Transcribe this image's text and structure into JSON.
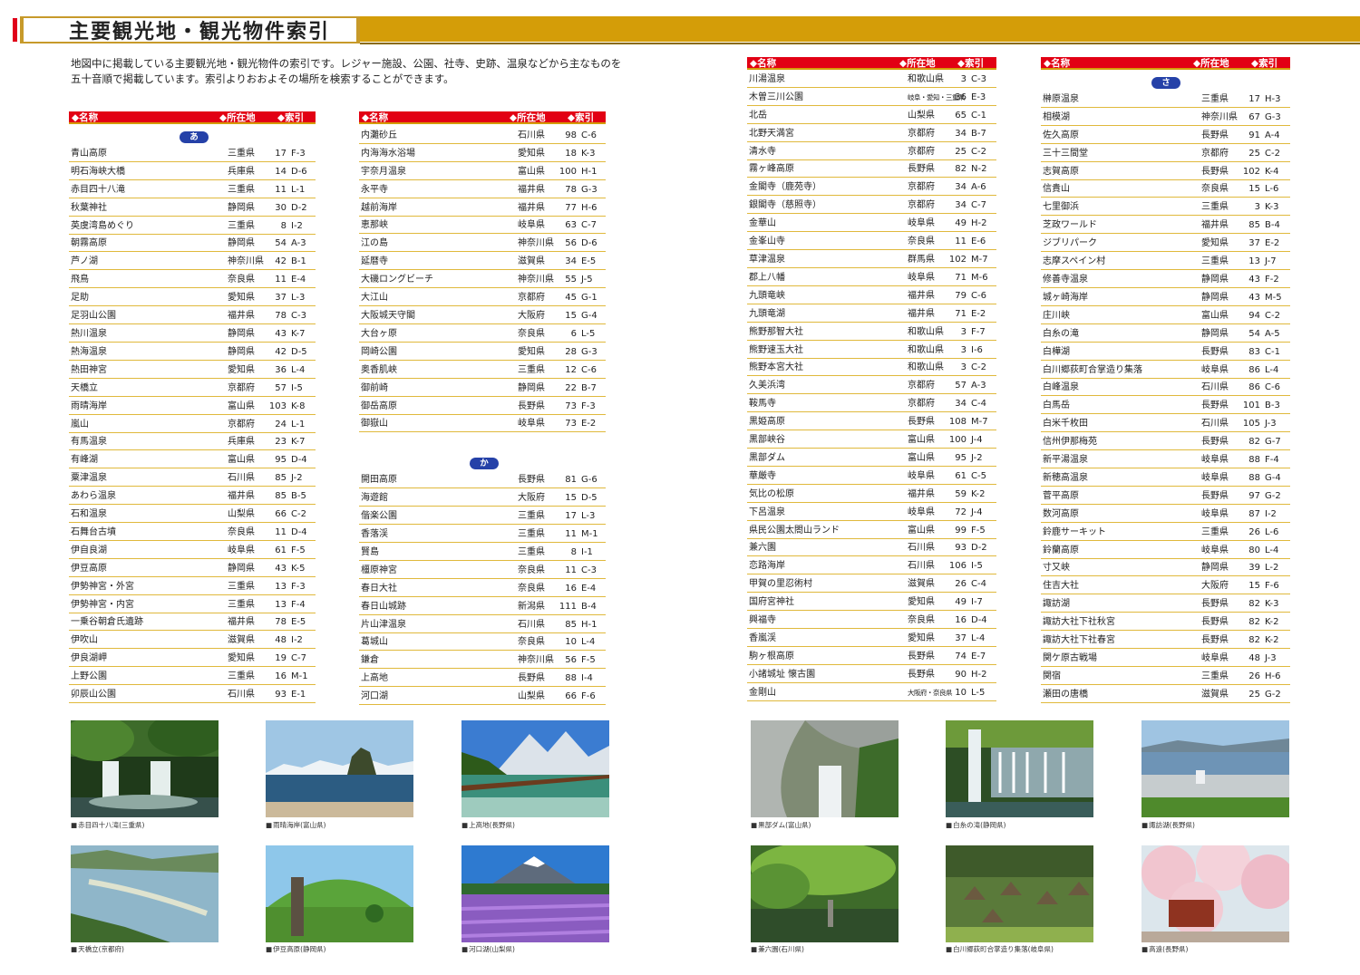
{
  "title": "主要観光地・観光物件索引",
  "intro": "地図中に掲載している主要観光地・観光物件の索引です。レジャー施設、公園、社寺、史跡、温泉などから主なものを五十音順で掲載しています。索引よりおおよその場所を検索することができます。",
  "header_labels": {
    "name": "◆名称",
    "pref": "◆所在地",
    "idx": "◆索引"
  },
  "section_a": "あ",
  "section_ka": "か",
  "section_sa": "さ",
  "col1": [
    [
      "青山高原",
      "三重県",
      "17",
      "F-3"
    ],
    [
      "明石海峡大橋",
      "兵庫県",
      "14",
      "D-6"
    ],
    [
      "赤目四十八滝",
      "三重県",
      "11",
      "L-1"
    ],
    [
      "秋葉神社",
      "静岡県",
      "30",
      "D-2"
    ],
    [
      "英虞湾島めぐり",
      "三重県",
      "8",
      "I-2"
    ],
    [
      "朝霧高原",
      "静岡県",
      "54",
      "A-3"
    ],
    [
      "芦ノ湖",
      "神奈川県",
      "42",
      "B-1"
    ],
    [
      "飛鳥",
      "奈良県",
      "11",
      "E-4"
    ],
    [
      "足助",
      "愛知県",
      "37",
      "L-3"
    ],
    [
      "足羽山公園",
      "福井県",
      "78",
      "C-3"
    ],
    [
      "熱川温泉",
      "静岡県",
      "43",
      "K-7"
    ],
    [
      "熱海温泉",
      "静岡県",
      "42",
      "D-5"
    ],
    [
      "熱田神宮",
      "愛知県",
      "36",
      "L-4"
    ],
    [
      "天橋立",
      "京都府",
      "57",
      "I-5"
    ],
    [
      "雨晴海岸",
      "富山県",
      "103",
      "K-8"
    ],
    [
      "嵐山",
      "京都府",
      "24",
      "L-1"
    ],
    [
      "有馬温泉",
      "兵庫県",
      "23",
      "K-7"
    ],
    [
      "有峰湖",
      "富山県",
      "95",
      "D-4"
    ],
    [
      "粟津温泉",
      "石川県",
      "85",
      "J-2"
    ],
    [
      "あわら温泉",
      "福井県",
      "85",
      "B-5"
    ],
    [
      "石和温泉",
      "山梨県",
      "66",
      "C-2"
    ],
    [
      "石舞台古墳",
      "奈良県",
      "11",
      "D-4"
    ],
    [
      "伊自良湖",
      "岐阜県",
      "61",
      "F-5"
    ],
    [
      "伊豆高原",
      "静岡県",
      "43",
      "K-5"
    ],
    [
      "伊勢神宮・外宮",
      "三重県",
      "13",
      "F-3"
    ],
    [
      "伊勢神宮・内宮",
      "三重県",
      "13",
      "F-4"
    ],
    [
      "一乗谷朝倉氏遺跡",
      "福井県",
      "78",
      "E-5"
    ],
    [
      "伊吹山",
      "滋賀県",
      "48",
      "I-2"
    ],
    [
      "伊良湖岬",
      "愛知県",
      "19",
      "C-7"
    ],
    [
      "上野公園",
      "三重県",
      "16",
      "M-1"
    ],
    [
      "卯辰山公園",
      "石川県",
      "93",
      "E-1"
    ]
  ],
  "col2a": [
    [
      "内灘砂丘",
      "石川県",
      "98",
      "C-6"
    ],
    [
      "内海海水浴場",
      "愛知県",
      "18",
      "K-3"
    ],
    [
      "宇奈月温泉",
      "富山県",
      "100",
      "H-1"
    ],
    [
      "永平寺",
      "福井県",
      "78",
      "G-3"
    ],
    [
      "越前海岸",
      "福井県",
      "77",
      "H-6"
    ],
    [
      "恵那峡",
      "岐阜県",
      "63",
      "C-7"
    ],
    [
      "江の島",
      "神奈川県",
      "56",
      "D-6"
    ],
    [
      "延暦寺",
      "滋賀県",
      "34",
      "E-5"
    ],
    [
      "大磯ロングビーチ",
      "神奈川県",
      "55",
      "J-5"
    ],
    [
      "大江山",
      "京都府",
      "45",
      "G-1"
    ],
    [
      "大阪城天守閣",
      "大阪府",
      "15",
      "G-4"
    ],
    [
      "大台ヶ原",
      "奈良県",
      "6",
      "L-5"
    ],
    [
      "岡崎公園",
      "愛知県",
      "28",
      "G-3"
    ],
    [
      "奥香肌峡",
      "三重県",
      "12",
      "C-6"
    ],
    [
      "御前崎",
      "静岡県",
      "22",
      "B-7"
    ],
    [
      "御岳高原",
      "長野県",
      "73",
      "F-3"
    ],
    [
      "御嶽山",
      "岐阜県",
      "73",
      "E-2"
    ]
  ],
  "col2b": [
    [
      "開田高原",
      "長野県",
      "81",
      "G-6"
    ],
    [
      "海遊館",
      "大阪府",
      "15",
      "D-5"
    ],
    [
      "偕楽公園",
      "三重県",
      "17",
      "L-3"
    ],
    [
      "香落渓",
      "三重県",
      "11",
      "M-1"
    ],
    [
      "賢島",
      "三重県",
      "8",
      "I-1"
    ],
    [
      "橿原神宮",
      "奈良県",
      "11",
      "C-3"
    ],
    [
      "春日大社",
      "奈良県",
      "16",
      "E-4"
    ],
    [
      "春日山城跡",
      "新潟県",
      "111",
      "B-4"
    ],
    [
      "片山津温泉",
      "石川県",
      "85",
      "H-1"
    ],
    [
      "葛城山",
      "奈良県",
      "10",
      "L-4"
    ],
    [
      "鎌倉",
      "神奈川県",
      "56",
      "F-5"
    ],
    [
      "上高地",
      "長野県",
      "88",
      "I-4"
    ],
    [
      "河口湖",
      "山梨県",
      "66",
      "F-6"
    ]
  ],
  "col3": [
    [
      "川湯温泉",
      "和歌山県",
      "3",
      "C-3"
    ],
    [
      "木曽三川公園",
      "岐阜・愛知・三重県",
      "36",
      "E-3"
    ],
    [
      "北岳",
      "山梨県",
      "65",
      "C-1"
    ],
    [
      "北野天満宮",
      "京都府",
      "34",
      "B-7"
    ],
    [
      "清水寺",
      "京都府",
      "25",
      "C-2"
    ],
    [
      "霧ヶ峰高原",
      "長野県",
      "82",
      "N-2"
    ],
    [
      "金閣寺（鹿苑寺）",
      "京都府",
      "34",
      "A-6"
    ],
    [
      "銀閣寺（慈照寺）",
      "京都府",
      "34",
      "C-7"
    ],
    [
      "金華山",
      "岐阜県",
      "49",
      "H-2"
    ],
    [
      "金峯山寺",
      "奈良県",
      "11",
      "E-6"
    ],
    [
      "草津温泉",
      "群馬県",
      "102",
      "M-7"
    ],
    [
      "郡上八幡",
      "岐阜県",
      "71",
      "M-6"
    ],
    [
      "九頭竜峡",
      "福井県",
      "79",
      "C-6"
    ],
    [
      "九頭竜湖",
      "福井県",
      "71",
      "E-2"
    ],
    [
      "熊野那智大社",
      "和歌山県",
      "3",
      "F-7"
    ],
    [
      "熊野速玉大社",
      "和歌山県",
      "3",
      "I-6"
    ],
    [
      "熊野本宮大社",
      "和歌山県",
      "3",
      "C-2"
    ],
    [
      "久美浜湾",
      "京都府",
      "57",
      "A-3"
    ],
    [
      "鞍馬寺",
      "京都府",
      "34",
      "C-4"
    ],
    [
      "黒姫高原",
      "長野県",
      "108",
      "M-7"
    ],
    [
      "黒部峡谷",
      "富山県",
      "100",
      "J-4"
    ],
    [
      "黒部ダム",
      "富山県",
      "95",
      "J-2"
    ],
    [
      "華厳寺",
      "岐阜県",
      "61",
      "C-5"
    ],
    [
      "気比の松原",
      "福井県",
      "59",
      "K-2"
    ],
    [
      "下呂温泉",
      "岐阜県",
      "72",
      "J-4"
    ],
    [
      "県民公園太閤山ランド",
      "富山県",
      "99",
      "F-5"
    ],
    [
      "兼六園",
      "石川県",
      "93",
      "D-2"
    ],
    [
      "恋路海岸",
      "石川県",
      "106",
      "I-5"
    ],
    [
      "甲賀の里忍術村",
      "滋賀県",
      "26",
      "C-4"
    ],
    [
      "国府宮神社",
      "愛知県",
      "49",
      "I-7"
    ],
    [
      "興福寺",
      "奈良県",
      "16",
      "D-4"
    ],
    [
      "香嵐渓",
      "愛知県",
      "37",
      "L-4"
    ],
    [
      "駒ヶ根高原",
      "長野県",
      "74",
      "E-7"
    ],
    [
      "小諸城址 懐古園",
      "長野県",
      "90",
      "H-2"
    ],
    [
      "金剛山",
      "大阪府・奈良県",
      "10",
      "L-5"
    ]
  ],
  "col4": [
    [
      "榊原温泉",
      "三重県",
      "17",
      "H-3"
    ],
    [
      "相模湖",
      "神奈川県",
      "67",
      "G-3"
    ],
    [
      "佐久高原",
      "長野県",
      "91",
      "A-4"
    ],
    [
      "三十三間堂",
      "京都府",
      "25",
      "C-2"
    ],
    [
      "志賀高原",
      "長野県",
      "102",
      "K-4"
    ],
    [
      "信貴山",
      "奈良県",
      "15",
      "L-6"
    ],
    [
      "七里御浜",
      "三重県",
      "3",
      "K-3"
    ],
    [
      "芝政ワールド",
      "福井県",
      "85",
      "B-4"
    ],
    [
      "ジブリパーク",
      "愛知県",
      "37",
      "E-2"
    ],
    [
      "志摩スペイン村",
      "三重県",
      "13",
      "J-7"
    ],
    [
      "修善寺温泉",
      "静岡県",
      "43",
      "F-2"
    ],
    [
      "城ヶ崎海岸",
      "静岡県",
      "43",
      "M-5"
    ],
    [
      "庄川峡",
      "富山県",
      "94",
      "C-2"
    ],
    [
      "白糸の滝",
      "静岡県",
      "54",
      "A-5"
    ],
    [
      "白樺湖",
      "長野県",
      "83",
      "C-1"
    ],
    [
      "白川郷荻町合掌造り集落",
      "岐阜県",
      "86",
      "L-4"
    ],
    [
      "白峰温泉",
      "石川県",
      "86",
      "C-6"
    ],
    [
      "白馬岳",
      "長野県",
      "101",
      "B-3"
    ],
    [
      "白米千枚田",
      "石川県",
      "105",
      "J-3"
    ],
    [
      "信州伊那梅苑",
      "長野県",
      "82",
      "G-7"
    ],
    [
      "新平湯温泉",
      "岐阜県",
      "88",
      "F-4"
    ],
    [
      "新穂高温泉",
      "岐阜県",
      "88",
      "G-4"
    ],
    [
      "菅平高原",
      "長野県",
      "97",
      "G-2"
    ],
    [
      "数河高原",
      "岐阜県",
      "87",
      "I-2"
    ],
    [
      "鈴鹿サーキット",
      "三重県",
      "26",
      "L-6"
    ],
    [
      "鈴蘭高原",
      "岐阜県",
      "80",
      "L-4"
    ],
    [
      "寸又峡",
      "静岡県",
      "39",
      "L-2"
    ],
    [
      "住吉大社",
      "大阪府",
      "15",
      "F-6"
    ],
    [
      "諏訪湖",
      "長野県",
      "82",
      "K-3"
    ],
    [
      "諏訪大社下社秋宮",
      "長野県",
      "82",
      "K-2"
    ],
    [
      "諏訪大社下社春宮",
      "長野県",
      "82",
      "K-2"
    ],
    [
      "関ケ原古戦場",
      "岐阜県",
      "48",
      "J-3"
    ],
    [
      "関宿",
      "三重県",
      "26",
      "H-6"
    ],
    [
      "瀬田の唐橋",
      "滋賀県",
      "25",
      "G-2"
    ]
  ],
  "captions": [
    "赤目四十八滝(三重県)",
    "雨晴海岸(富山県)",
    "上高地(長野県)",
    "天橋立(京都府)",
    "伊豆高原(静岡県)",
    "河口湖(山梨県)",
    "黒部ダム(富山県)",
    "白糸の滝(静岡県)",
    "諏訪湖(長野県)",
    "兼六園(石川県)",
    "白川郷荻町合掌造り集落(岐阜県)",
    "高遠(長野県)"
  ],
  "colors": {
    "red": "#e20014",
    "gold": "#d49d08",
    "pill": "#2541a8"
  }
}
